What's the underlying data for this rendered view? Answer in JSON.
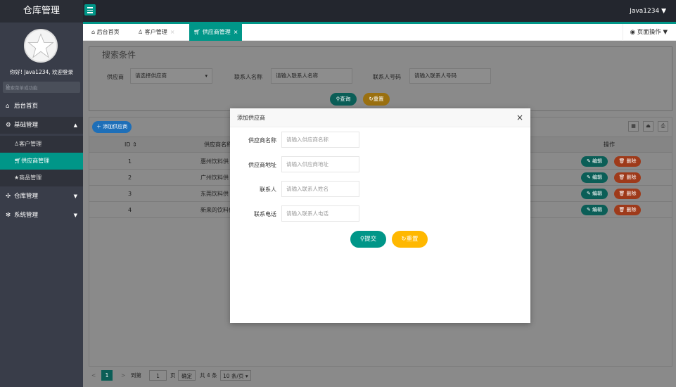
{
  "topbar": {
    "logo": "仓库管理",
    "user": "Java1234 ▼"
  },
  "sidebar": {
    "welcome": "你好! Java1234, 欢迎登录",
    "search_placeholder": "搜索菜单或功能",
    "items": [
      {
        "label": "后台首页",
        "icon": "home-icon"
      },
      {
        "label": "基础管理",
        "icon": "settings-icon",
        "arrow": "▲"
      },
      {
        "label": "客户管理",
        "icon": "user-icon"
      },
      {
        "label": "供应商管理",
        "icon": "cart-icon"
      },
      {
        "label": "商品管理",
        "icon": "star-icon"
      },
      {
        "label": "仓库管理",
        "icon": "puzzle-icon",
        "arrow": "▼"
      },
      {
        "label": "系统管理",
        "icon": "gear-icon",
        "arrow": "▼"
      }
    ]
  },
  "tabs": [
    {
      "label": "后台首页"
    },
    {
      "label": "客户管理",
      "close": "×"
    },
    {
      "label": "供应商管理",
      "close": "×"
    }
  ],
  "page_ops": "页面操作 ▼",
  "search": {
    "legend": "搜索条件",
    "supplier_label": "供应商",
    "supplier_value": "请选择供应商",
    "contact_name_label": "联系人名称",
    "contact_name_placeholder": "请输入联系人名称",
    "contact_phone_label": "联系人号码",
    "contact_phone_placeholder": "请输入联系人号码",
    "query_btn": "查询",
    "reset_btn": "重置"
  },
  "table": {
    "add_btn": "添加供应商",
    "headers": [
      "ID ⇕",
      "供应商名称",
      "操作"
    ],
    "rows": [
      {
        "id": "1",
        "name": "惠州饮料供"
      },
      {
        "id": "2",
        "name": "广州饮料供"
      },
      {
        "id": "3",
        "name": "东莞饮料供"
      },
      {
        "id": "4",
        "name": "新来的饮料供"
      }
    ],
    "edit_label": "编辑",
    "delete_label": "删除"
  },
  "pager": {
    "prev": "<",
    "current": "1",
    "next": ">",
    "goto": "到第",
    "page_input": "1",
    "page_unit": "页",
    "confirm": "确定",
    "total": "共 4 条",
    "per_page": "10 条/页 ▾"
  },
  "modal": {
    "title": "添加供应商",
    "close": "×",
    "fields": [
      {
        "label": "供应商名称",
        "placeholder": "请输入供应商名称"
      },
      {
        "label": "供应商地址",
        "placeholder": "请输入供应商地址"
      },
      {
        "label": "联系人",
        "placeholder": "请输入联系人姓名"
      },
      {
        "label": "联系电话",
        "placeholder": "请输入联系人电话"
      }
    ],
    "submit": "提交",
    "reset": "重置"
  },
  "colors": {
    "teal": "#009688",
    "orange": "#ffb800",
    "red": "#ff5722",
    "blue": "#1e9fff",
    "sidebar": "#393d49",
    "topbar": "#23262e"
  }
}
